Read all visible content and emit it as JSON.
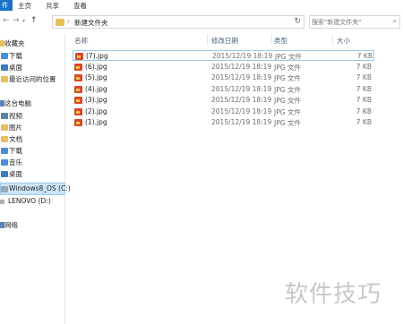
{
  "ribbon": {
    "file_tab": "件",
    "tabs": [
      "主页",
      "共享",
      "查看"
    ]
  },
  "address": {
    "path": "新建文件夹",
    "separator": "›"
  },
  "search": {
    "placeholder": "搜索\"新建文件夹\""
  },
  "nav": {
    "items": [
      {
        "label": "收藏夹",
        "icon": "star-icon"
      },
      {
        "label": "下载",
        "icon": "download-folder-icon"
      },
      {
        "label": "桌面",
        "icon": "desktop-folder-icon"
      },
      {
        "label": "最近访问的位置",
        "icon": "recent-places-icon"
      },
      {
        "label": "这台电脑",
        "icon": "computer-icon"
      },
      {
        "label": "视频",
        "icon": "videos-folder-icon"
      },
      {
        "label": "图片",
        "icon": "pictures-folder-icon"
      },
      {
        "label": "文档",
        "icon": "documents-folder-icon"
      },
      {
        "label": "下载",
        "icon": "download-folder-icon"
      },
      {
        "label": "音乐",
        "icon": "music-folder-icon"
      },
      {
        "label": "桌面",
        "icon": "desktop-folder-icon"
      },
      {
        "label": "Windows8_OS (C:)",
        "icon": "drive-icon",
        "selected": true
      },
      {
        "label": "LENOVO (D:)",
        "icon": "drive-icon"
      },
      {
        "label": "网络",
        "icon": "network-icon"
      }
    ]
  },
  "columns": {
    "name": "名称",
    "date": "修改日期",
    "type": "类型",
    "size": "大小"
  },
  "files": [
    {
      "name": "(7).jpg",
      "date": "2015/12/19 18:19",
      "type": "JPG 文件",
      "size": "7 KB"
    },
    {
      "name": "(6).jpg",
      "date": "2015/12/19 18:19",
      "type": "JPG 文件",
      "size": "7 KB"
    },
    {
      "name": "(5).jpg",
      "date": "2015/12/19 18:19",
      "type": "JPG 文件",
      "size": "7 KB"
    },
    {
      "name": "(4).jpg",
      "date": "2015/12/19 18:19",
      "type": "JPG 文件",
      "size": "7 KB"
    },
    {
      "name": "(3).jpg",
      "date": "2015/12/19 18:19",
      "type": "JPG 文件",
      "size": "7 KB"
    },
    {
      "name": "(2).jpg",
      "date": "2015/12/19 18:19",
      "type": "JPG 文件",
      "size": "7 KB"
    },
    {
      "name": "(1).jpg",
      "date": "2015/12/19 18:19",
      "type": "JPG 文件",
      "size": "7 KB"
    }
  ],
  "watermark": "软件技巧",
  "colors": {
    "accent": "#1a73c8",
    "selection": "#cce4f7",
    "folder": "#e8bf5a"
  }
}
